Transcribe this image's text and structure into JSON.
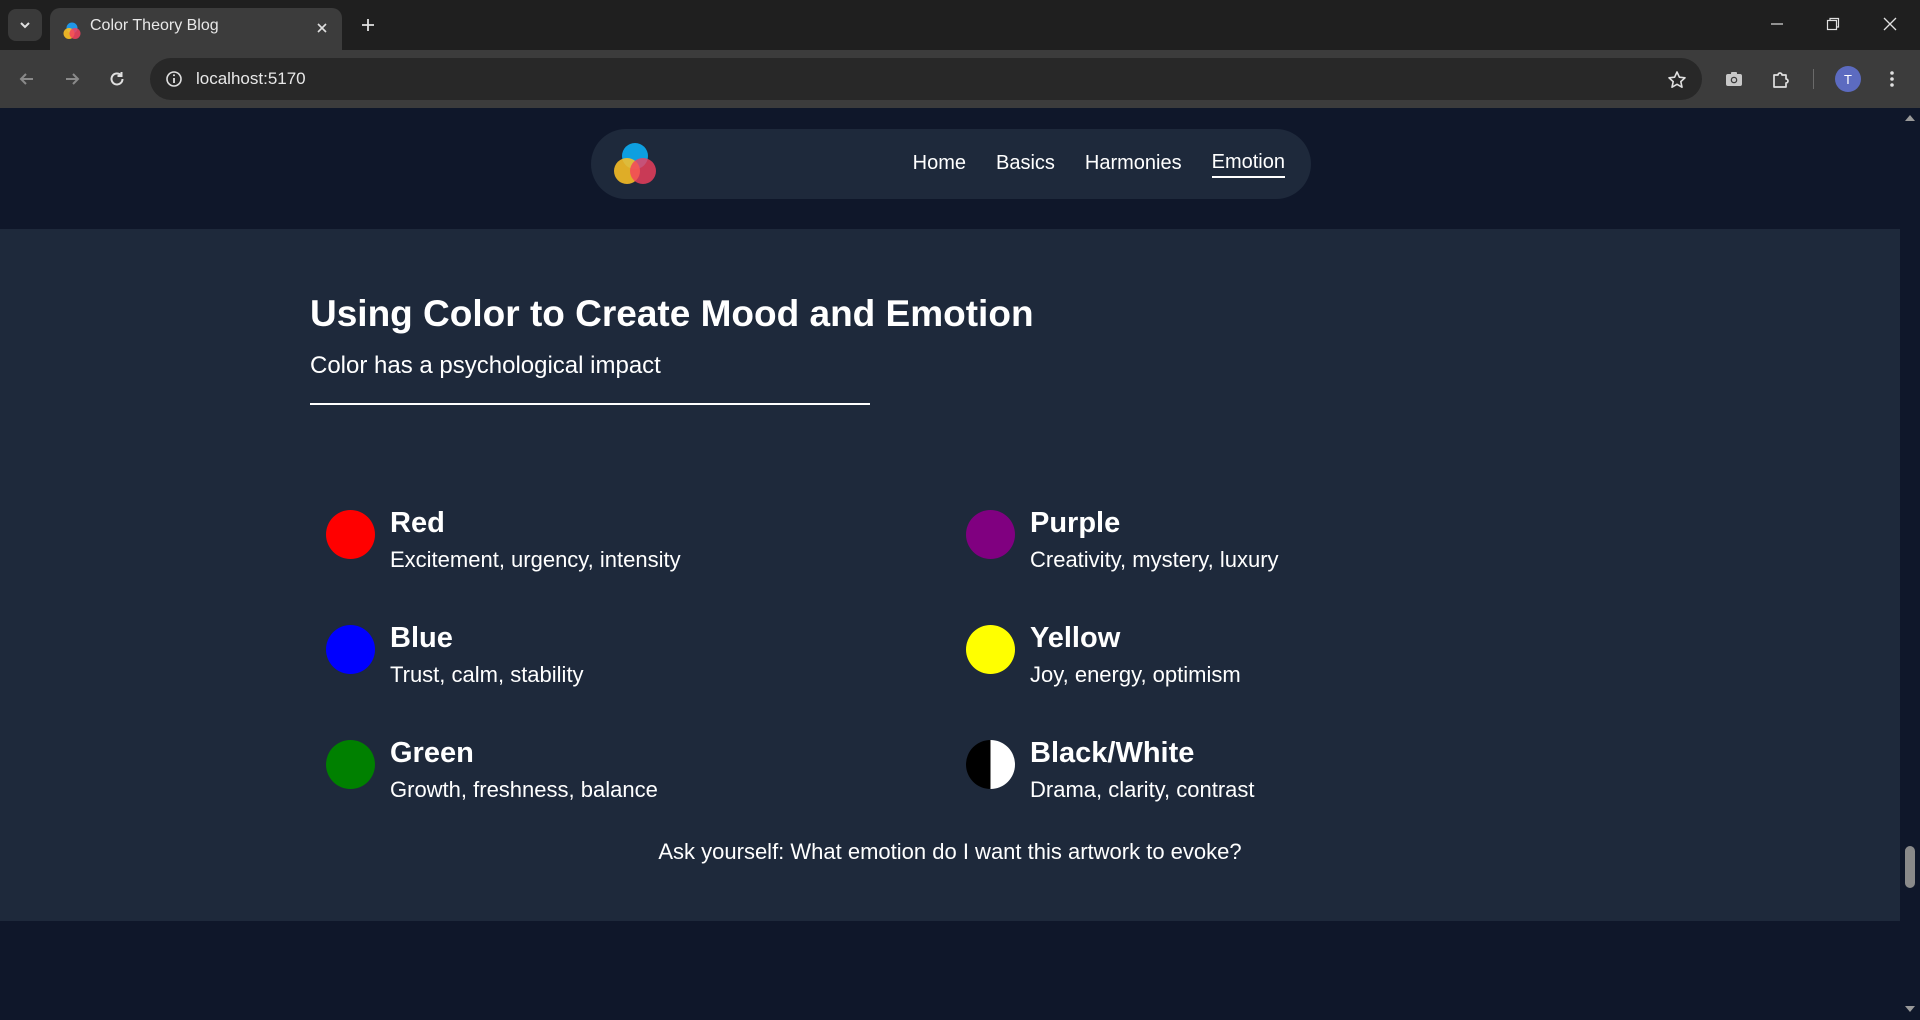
{
  "browser": {
    "tab_title": "Color Theory Blog",
    "url": "localhost:5170",
    "profile_initial": "T",
    "icons": {
      "tab_search": "chevron-down-icon",
      "tab_close": "close-icon",
      "new_tab": "plus-icon",
      "back": "arrow-left-icon",
      "forward": "arrow-right-icon",
      "reload": "reload-icon",
      "site_info": "info-icon",
      "bookmark": "star-icon",
      "screenshot": "camera-icon",
      "extensions": "puzzle-icon",
      "menu": "kebab-menu-icon"
    }
  },
  "nav": {
    "logo": "color-circles-logo",
    "links": [
      "Home",
      "Basics",
      "Harmonies",
      "Emotion"
    ],
    "active": "Emotion"
  },
  "section": {
    "title": "Using Color to Create Mood and Emotion",
    "subtitle": "Color has a psychological impact",
    "emotions": [
      {
        "name": "Red",
        "description": "Excitement, urgency, intensity",
        "color": "#ff0000"
      },
      {
        "name": "Purple",
        "description": "Creativity, mystery, luxury",
        "color": "#800080"
      },
      {
        "name": "Blue",
        "description": "Trust, calm, stability",
        "color": "#0000ff"
      },
      {
        "name": "Yellow",
        "description": "Joy, energy, optimism",
        "color": "#ffff00"
      },
      {
        "name": "Green",
        "description": "Growth, freshness, balance",
        "color": "#008000"
      },
      {
        "name": "Black/White",
        "description": "Drama, clarity, contrast",
        "color": "#000000/#ffffff"
      }
    ],
    "prompt": "Ask yourself: What emotion do I want this artwork to evoke?"
  },
  "colors": {
    "page_bg": "#0f172a",
    "section_bg": "#1e293b",
    "navbar_bg": "#1e293b",
    "text": "#ffffff"
  }
}
